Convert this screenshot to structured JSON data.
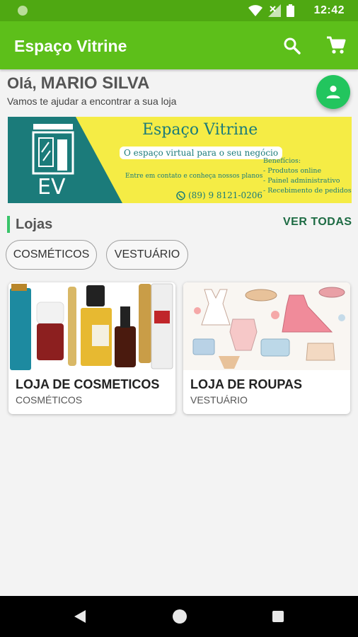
{
  "status_bar": {
    "time": "12:42"
  },
  "app_bar": {
    "title": "Espaço Vitrine",
    "search_icon": "search-icon",
    "cart_icon": "cart-icon"
  },
  "greeting": {
    "hello": "Olá,",
    "name": "MARIO SILVA",
    "subtitle": "Vamos te ajudar a encontrar a sua loja"
  },
  "banner": {
    "title": "Espaço Vitrine",
    "slogan": "O espaço virtual para o seu negócio",
    "contact": "Entre em contato e conheça nossos planos",
    "phone": "(89) 9 8121-0206",
    "benefits_title": "Benefícios:",
    "benefits": [
      "- Produtos online",
      "- Painel administrativo",
      "- Recebimento de pedidos"
    ],
    "logo_text": "EV"
  },
  "stores_section": {
    "title": "Lojas",
    "see_all": "VER TODAS",
    "categories": [
      "COSMÉTICOS",
      "VESTUÁRIO"
    ],
    "stores": [
      {
        "name": "LOJA DE COSMETICOS",
        "category": "COSMÉTICOS"
      },
      {
        "name": "LOJA DE ROUPAS",
        "category": "VESTUÁRIO"
      }
    ]
  },
  "colors": {
    "status_bar": "#4fa812",
    "app_bar": "#5dbf1a",
    "fab": "#22c55e",
    "accent_text": "#1d6b43",
    "banner_teal": "#1b7b7a",
    "banner_yellow": "#f5ec45"
  }
}
